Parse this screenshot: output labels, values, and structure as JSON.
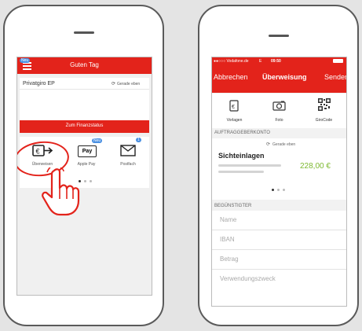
{
  "left": {
    "header": {
      "badge": "Neu",
      "title": "Guten Tag"
    },
    "account": {
      "name": "Privatgiro EP",
      "refresh": "Gerade eben"
    },
    "status_button": "Zum Finanzstatus",
    "tiles": [
      {
        "label": "Überweisen",
        "icon": "transfer-card-icon",
        "badge": ""
      },
      {
        "label": "Apple Pay",
        "icon": "apple-pay-icon",
        "badge": "Neu"
      },
      {
        "label": "Postfach",
        "icon": "mail-icon",
        "badge": "1"
      }
    ],
    "colors": {
      "accent": "#e3231b",
      "badge": "#4a90e2",
      "highlight": "#e3231b"
    }
  },
  "right": {
    "status_bar": {
      "carrier": "●●○○○ Vodafone.de",
      "network": "E",
      "time": "09:50"
    },
    "nav": {
      "cancel": "Abbrechen",
      "title": "Überweisung",
      "send": "Senden"
    },
    "tools": [
      {
        "label": "Vorlagen",
        "icon": "templates-icon"
      },
      {
        "label": "Foto",
        "icon": "camera-icon"
      },
      {
        "label": "GiroCode",
        "icon": "qr-code-icon"
      }
    ],
    "sender_section": "AUFTRAGGEBERKONTO",
    "sender": {
      "refresh": "Gerade eben",
      "account_name": "Sichteinlagen",
      "balance": "228,00 €"
    },
    "recipient_section": "BEGÜNSTIGTER",
    "fields": {
      "name": "Name",
      "iban": "IBAN",
      "amount": "Betrag",
      "purpose": "Verwendungszweck"
    },
    "colors": {
      "balance": "#7cb82f"
    }
  }
}
